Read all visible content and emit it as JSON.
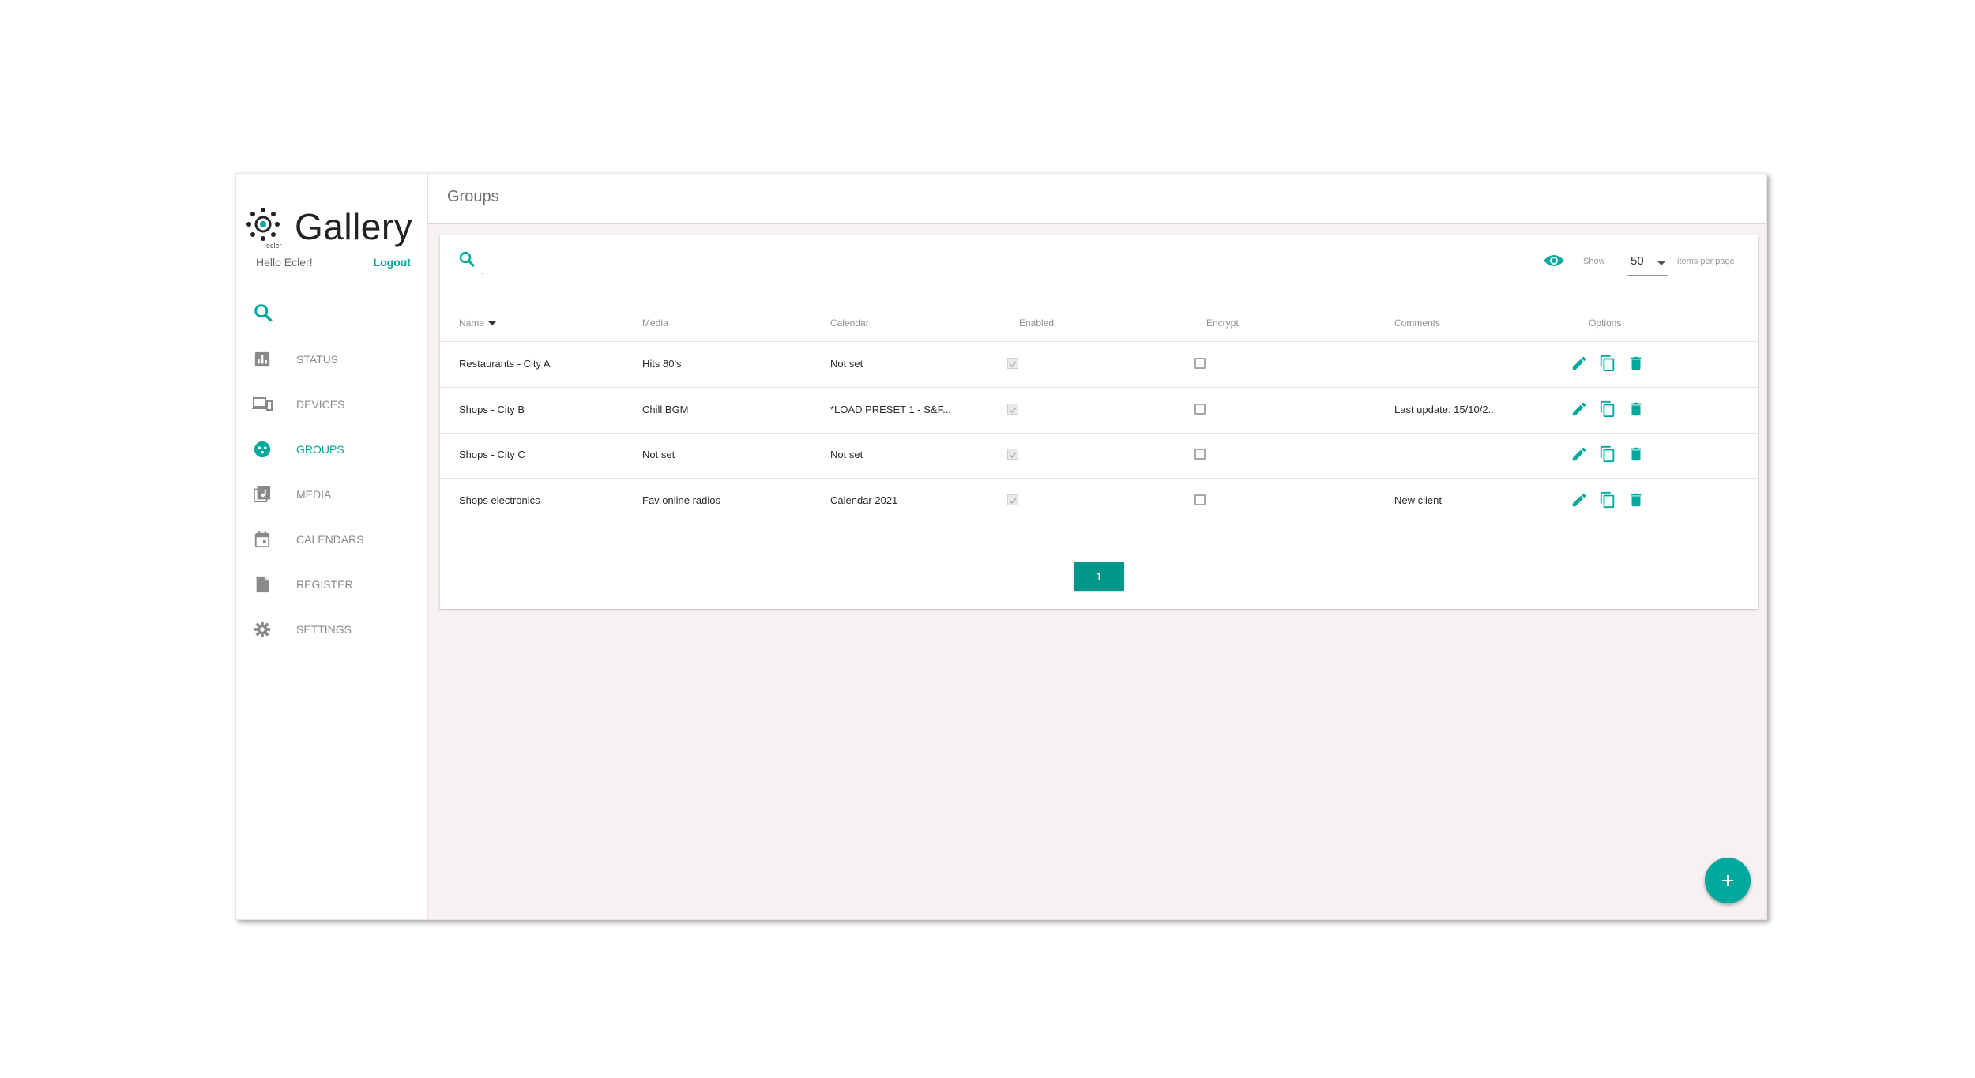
{
  "brand": {
    "name": "Gallery",
    "sub": "ecler",
    "accent": "#00a99d"
  },
  "sidebar": {
    "greeting": "Hello Ecler!",
    "logout": "Logout",
    "items": [
      {
        "label": "STATUS",
        "icon": "bar-chart-icon"
      },
      {
        "label": "DEVICES",
        "icon": "devices-icon"
      },
      {
        "label": "GROUPS",
        "icon": "groups-icon",
        "active": true
      },
      {
        "label": "MEDIA",
        "icon": "media-library-icon"
      },
      {
        "label": "CALENDARS",
        "icon": "calendar-icon"
      },
      {
        "label": "REGISTER",
        "icon": "document-icon"
      },
      {
        "label": "SETTINGS",
        "icon": "gear-icon"
      }
    ]
  },
  "header": {
    "title": "Groups"
  },
  "toolbar": {
    "show_label": "Show",
    "per_page_value": "50",
    "per_page_label": "items per page"
  },
  "table": {
    "columns": [
      "Name",
      "Media",
      "Calendar",
      "Enabled",
      "Encrypt.",
      "Comments",
      "Options"
    ],
    "rows": [
      {
        "name": "Restaurants - City A",
        "media": "Hits 80's",
        "calendar": "Not set",
        "enabled": true,
        "encrypt": false,
        "comments": ""
      },
      {
        "name": "Shops - City B",
        "media": "Chill BGM",
        "calendar": "*LOAD PRESET 1 - S&F...",
        "enabled": true,
        "encrypt": false,
        "comments": "Last update: 15/10/2..."
      },
      {
        "name": "Shops - City C",
        "media": "Not set",
        "calendar": "Not set",
        "enabled": true,
        "encrypt": false,
        "comments": ""
      },
      {
        "name": "Shops electronics",
        "media": "Fav online radios",
        "calendar": "Calendar 2021",
        "enabled": true,
        "encrypt": false,
        "comments": "New client"
      }
    ]
  },
  "pagination": {
    "current": "1"
  }
}
